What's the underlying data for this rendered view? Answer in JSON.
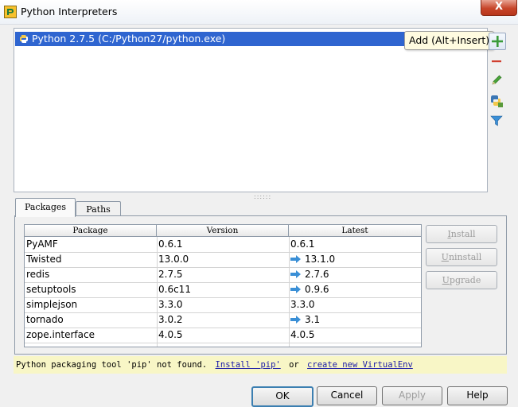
{
  "window": {
    "title": "Python Interpreters",
    "close_label": "X"
  },
  "interpreters": [
    {
      "label": "Python 2.7.5 (C:/Python27/python.exe)",
      "selected": true
    }
  ],
  "tooltip": "Add (Alt+Insert)",
  "side_toolbar": {
    "add_icon": "plus-icon",
    "remove_icon": "minus-icon",
    "edit_icon": "pencil-icon",
    "details_icon": "python-details-icon",
    "filter_icon": "filter-icon"
  },
  "splitter_grip": "::::::",
  "tabs": [
    {
      "label": "Packages",
      "active": true
    },
    {
      "label": "Paths",
      "active": false
    }
  ],
  "packages_table": {
    "columns": [
      "Package",
      "Version",
      "Latest"
    ],
    "rows": [
      {
        "package": "PyAMF",
        "version": "0.6.1",
        "latest": "0.6.1",
        "upgrade": false
      },
      {
        "package": "Twisted",
        "version": "13.0.0",
        "latest": "13.1.0",
        "upgrade": true
      },
      {
        "package": "redis",
        "version": "2.7.5",
        "latest": "2.7.6",
        "upgrade": true
      },
      {
        "package": "setuptools",
        "version": "0.6c11",
        "latest": "0.9.6",
        "upgrade": true
      },
      {
        "package": "simplejson",
        "version": "3.3.0",
        "latest": "3.3.0",
        "upgrade": false
      },
      {
        "package": "tornado",
        "version": "3.0.2",
        "latest": "3.1",
        "upgrade": true
      },
      {
        "package": "zope.interface",
        "version": "4.0.5",
        "latest": "4.0.5",
        "upgrade": false
      }
    ]
  },
  "package_buttons": {
    "install": "Install",
    "uninstall": "Uninstall",
    "upgrade": "Upgrade"
  },
  "notice": {
    "text": "Python packaging tool 'pip' not found.",
    "install_link": "Install 'pip'",
    "or_text": "or",
    "virtualenv_link": "create new VirtualEnv"
  },
  "dialog_buttons": {
    "ok": "OK",
    "cancel": "Cancel",
    "apply": "Apply",
    "help": "Help"
  },
  "colors": {
    "selection": "#2f65d0",
    "upgrade_arrow": "#3a8fd6",
    "notice_background": "#f8f6c6",
    "link": "#1a1aa8"
  }
}
